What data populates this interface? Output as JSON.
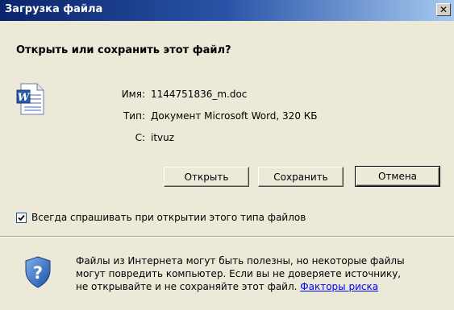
{
  "window": {
    "title": "Загрузка файла",
    "close_symbol": "✕"
  },
  "dialog": {
    "question": "Открыть или сохранить этот файл?",
    "file_icon": "word-document-icon",
    "info": [
      {
        "label": "Имя:",
        "value": "1144751836_m.doc"
      },
      {
        "label": "Тип:",
        "value": "Документ Microsoft Word, 320 КБ"
      },
      {
        "label": "С:",
        "value": "itvuz"
      }
    ],
    "buttons": {
      "open": "Открыть",
      "save": "Сохранить",
      "cancel": "Отмена"
    },
    "checkbox": {
      "checked": true,
      "label": "Всегда спрашивать при открытии этого типа файлов"
    },
    "warning": {
      "icon": "shield-question-icon",
      "line1": "Файлы из Интернета могут быть полезны, но некоторые файлы",
      "line2": "могут повредить компьютер. Если вы не доверяете источнику,",
      "line3_prefix": "не открывайте и не сохраняйте этот файл.",
      "link": "Факторы риска"
    }
  }
}
